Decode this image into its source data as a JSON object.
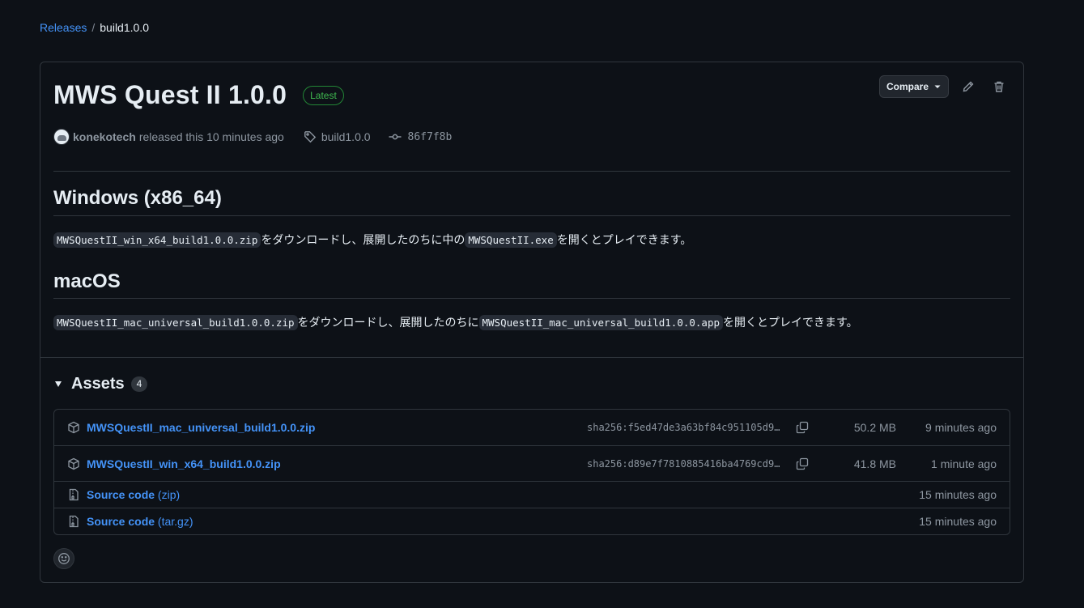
{
  "breadcrumb": {
    "releases": "Releases",
    "separator": "/",
    "current": "build1.0.0"
  },
  "release": {
    "title": "MWS Quest II 1.0.0",
    "badge": "Latest",
    "compare_label": "Compare",
    "author": "konekotech",
    "released_text": "released this 10 minutes ago",
    "tag": "build1.0.0",
    "commit": "86f7f8b"
  },
  "notes": {
    "windows_heading": "Windows (x86_64)",
    "windows_file": "MWSQuestII_win_x64_build1.0.0.zip",
    "windows_text1": "をダウンロードし、展開したのちに中の",
    "windows_exe": "MWSQuestII.exe",
    "windows_text2": "を開くとプレイできます。",
    "mac_heading": "macOS",
    "mac_file": "MWSQuestII_mac_universal_build1.0.0.zip",
    "mac_text1": "をダウンロードし、展開したのちに",
    "mac_app": "MWSQuestII_mac_universal_build1.0.0.app",
    "mac_text2": "を開くとプレイできます。"
  },
  "assets": {
    "title": "Assets",
    "count": "4",
    "items": [
      {
        "name": "MWSQuestII_mac_universal_build1.0.0.zip",
        "sha": "sha256:f5ed47de3a63bf84c951105d9…",
        "size": "50.2 MB",
        "time": "9 minutes ago"
      },
      {
        "name": "MWSQuestII_win_x64_build1.0.0.zip",
        "sha": "sha256:d89e7f7810885416ba4769cd9…",
        "size": "41.8 MB",
        "time": "1 minute ago"
      },
      {
        "name": "Source code",
        "sub": "(zip)",
        "time": "15 minutes ago"
      },
      {
        "name": "Source code",
        "sub": "(tar.gz)",
        "time": "15 minutes ago"
      }
    ]
  },
  "colors": {
    "background": "#0d1117",
    "link": "#4493f8",
    "border": "#30363d",
    "latest": "#3fb950"
  }
}
